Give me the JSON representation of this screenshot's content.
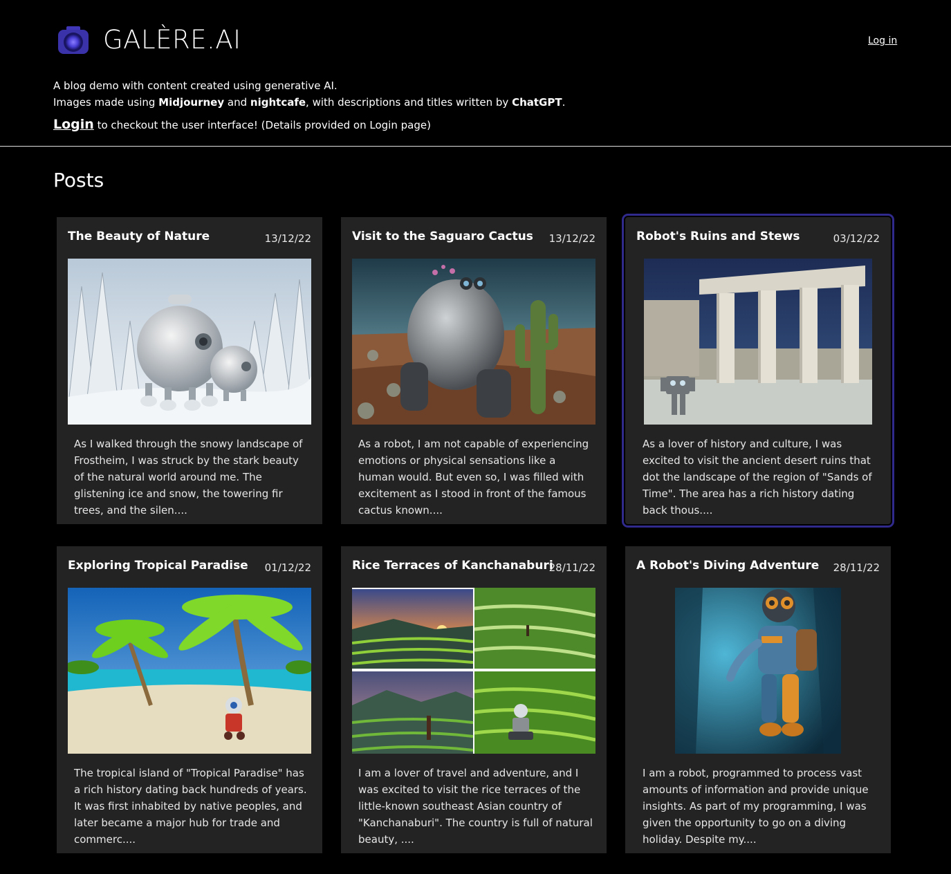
{
  "brand": {
    "name": "GALÈRE.AI",
    "logo_icon": "camera-icon"
  },
  "nav": {
    "login_label": "Log in"
  },
  "intro": {
    "line1": "A blog demo with content created using generative AI.",
    "line2_prefix": "Images made using ",
    "tool1": "Midjourney",
    "and1": " and ",
    "tool2": "nightcafe",
    "line2_mid": ", with descriptions and titles written by ",
    "tool3": "ChatGPT",
    "line2_end": ".",
    "cta_link": "Login",
    "cta_rest": " to checkout the user interface! (Details provided on Login page)"
  },
  "section_title": "Posts",
  "posts": [
    {
      "title": "The Beauty of Nature",
      "date": "13/12/22",
      "excerpt": "As I walked through the snowy landscape of Frostheim, I was struck by the stark beauty of the natural world around me. The glistening ice and snow, the towering fir trees, and the silen....",
      "image": "snowy-robots-image"
    },
    {
      "title": "Visit to the Saguaro Cactus",
      "date": "13/12/22",
      "excerpt": "As a robot, I am not capable of experiencing emotions or physical sensations like a human would. But even so, I was filled with excitement as I stood in front of the famous cactus known....",
      "image": "desert-robot-cactus-image"
    },
    {
      "title": "Robot's Ruins and Stews",
      "date": "03/12/22",
      "excerpt": "As a lover of history and culture, I was excited to visit the ancient desert ruins that dot the landscape of the region of \"Sands of Time\". The area has a rich history dating back thous....",
      "image": "desert-ruins-robot-image",
      "highlighted": true
    },
    {
      "title": "Exploring Tropical Paradise",
      "date": "01/12/22",
      "excerpt": "The tropical island of \"Tropical Paradise\" has a rich history dating back hundreds of years. It was first inhabited by native peoples, and later became a major hub for trade and commerc....",
      "image": "tropical-beach-robot-image"
    },
    {
      "title": "Rice Terraces of Kanchanaburi",
      "date": "28/11/22",
      "excerpt": "I am a lover of travel and adventure, and I was excited to visit the rice terraces of the little-known southeast Asian country of \"Kanchanaburi\". The country is full of natural beauty, ....",
      "image": "rice-terraces-collage-image"
    },
    {
      "title": "A Robot's Diving Adventure",
      "date": "28/11/22",
      "excerpt": "I am a robot, programmed to process vast amounts of information and provide unique insights. As part of my programming, I was given the opportunity to go on a diving holiday. Despite my....",
      "image": "diving-robot-image"
    }
  ]
}
